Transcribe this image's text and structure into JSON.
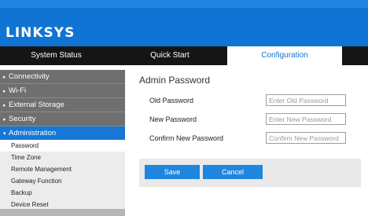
{
  "brand": {
    "logo_text": "LINKSYS"
  },
  "colors": {
    "accent": "#0f74d4",
    "nav_bg": "#151515",
    "sidebar_item": "#6f6f6f",
    "button": "#1f86e0"
  },
  "topnav": {
    "tabs": [
      {
        "label": "System Status",
        "selected": false
      },
      {
        "label": "Quick Start",
        "selected": false
      },
      {
        "label": "Configuration",
        "selected": true
      }
    ]
  },
  "sidebar": {
    "items": [
      {
        "label": "Connectivity",
        "icon": "caret-right-icon"
      },
      {
        "label": "Wi-Fi",
        "icon": "caret-right-icon"
      },
      {
        "label": "External Storage",
        "icon": "caret-right-icon"
      },
      {
        "label": "Security",
        "icon": "caret-right-icon"
      },
      {
        "label": "Administration",
        "icon": "caret-down-icon",
        "expanded": true
      }
    ],
    "subitems": [
      {
        "label": "Password",
        "selected": true
      },
      {
        "label": "Time Zone"
      },
      {
        "label": "Remote Management"
      },
      {
        "label": "Gateway Function"
      },
      {
        "label": "Backup"
      },
      {
        "label": "Device Reset"
      }
    ]
  },
  "main": {
    "title": "Admin Password",
    "fields": [
      {
        "label": "Old Password",
        "placeholder": "Enter Old Password",
        "value": ""
      },
      {
        "label": "New Password",
        "placeholder": "Enter New Password",
        "value": ""
      },
      {
        "label": "Confirm New Password",
        "placeholder": "Confirm New Password",
        "value": ""
      }
    ],
    "buttons": {
      "save": "Save",
      "cancel": "Cancel"
    }
  }
}
